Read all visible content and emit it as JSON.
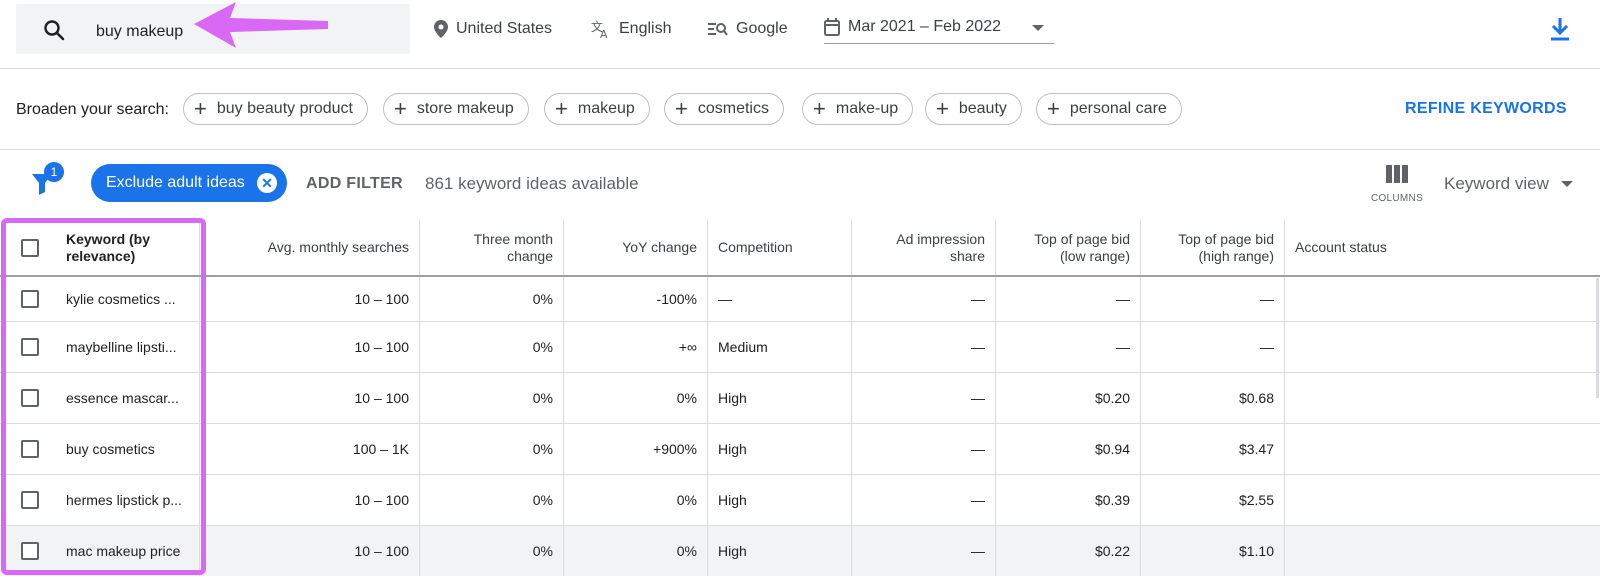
{
  "search": {
    "query": "buy makeup"
  },
  "toolbar": {
    "location": "United States",
    "language": "English",
    "network": "Google",
    "date_range": "Mar 2021 – Feb 2022"
  },
  "broaden": {
    "label": "Broaden your search:",
    "chips": [
      "buy beauty product",
      "store makeup",
      "makeup",
      "cosmetics",
      "make-up",
      "beauty",
      "personal care"
    ],
    "refine_label": "REFINE KEYWORDS"
  },
  "filters": {
    "badge_count": "1",
    "active_filter": "Exclude adult ideas",
    "add_filter_label": "ADD FILTER",
    "ideas_count": "861 keyword ideas available",
    "columns_label": "COLUMNS",
    "view_label": "Keyword view"
  },
  "table": {
    "headers": {
      "keyword": "Keyword (by relevance)",
      "avg": "Avg. monthly searches",
      "three_month": "Three month change",
      "yoy": "YoY change",
      "competition": "Competition",
      "impression": "Ad impression share",
      "bid_low": "Top of page bid (low range)",
      "bid_high": "Top of page bid (high range)",
      "status": "Account status"
    },
    "rows": [
      {
        "keyword": "kylie cosmetics ...",
        "avg": "10 – 100",
        "three_month": "0%",
        "yoy": "-100%",
        "competition": "—",
        "impression": "—",
        "bid_low": "—",
        "bid_high": "—",
        "status": ""
      },
      {
        "keyword": "maybelline lipsti...",
        "avg": "10 – 100",
        "three_month": "0%",
        "yoy": "+∞",
        "competition": "Medium",
        "impression": "—",
        "bid_low": "—",
        "bid_high": "—",
        "status": ""
      },
      {
        "keyword": "essence mascar...",
        "avg": "10 – 100",
        "three_month": "0%",
        "yoy": "0%",
        "competition": "High",
        "impression": "—",
        "bid_low": "$0.20",
        "bid_high": "$0.68",
        "status": ""
      },
      {
        "keyword": "buy cosmetics",
        "avg": "100 – 1K",
        "three_month": "0%",
        "yoy": "+900%",
        "competition": "High",
        "impression": "—",
        "bid_low": "$0.94",
        "bid_high": "$3.47",
        "status": ""
      },
      {
        "keyword": "hermes lipstick p...",
        "avg": "10 – 100",
        "three_month": "0%",
        "yoy": "0%",
        "competition": "High",
        "impression": "—",
        "bid_low": "$0.39",
        "bid_high": "$2.55",
        "status": ""
      },
      {
        "keyword": "mac makeup price",
        "avg": "10 – 100",
        "three_month": "0%",
        "yoy": "0%",
        "competition": "High",
        "impression": "—",
        "bid_low": "$0.22",
        "bid_high": "$1.10",
        "status": ""
      }
    ]
  },
  "colors": {
    "accent": "#1a73e8",
    "annotation": "#d968f5"
  }
}
